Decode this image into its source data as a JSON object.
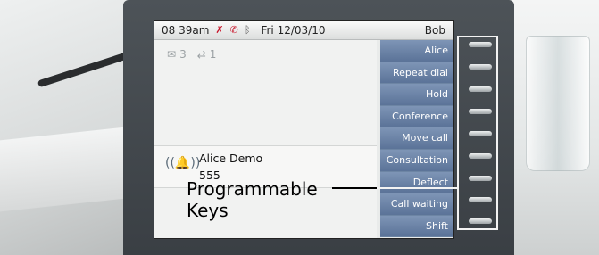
{
  "status_bar": {
    "time": "08 39am",
    "date": "Fri 12/03/10",
    "user": "Bob",
    "icons": [
      "mute-icon",
      "call-forward-icon",
      "bluetooth-icon"
    ]
  },
  "counters": {
    "messages": "3",
    "calls": "1"
  },
  "active_call": {
    "name": "Alice Demo",
    "number": "555"
  },
  "programmable_keys": [
    "Alice",
    "Repeat dial",
    "Hold",
    "Conference",
    "Move call",
    "Consultation",
    "Deflect",
    "Call waiting",
    "Shift"
  ],
  "annotation": {
    "line1": "Programmable",
    "line2": "Keys"
  },
  "colors": {
    "key_gradient_top": "#7e95b6",
    "key_gradient_bottom": "#5b7398",
    "phone_body": "#3a3f44"
  }
}
